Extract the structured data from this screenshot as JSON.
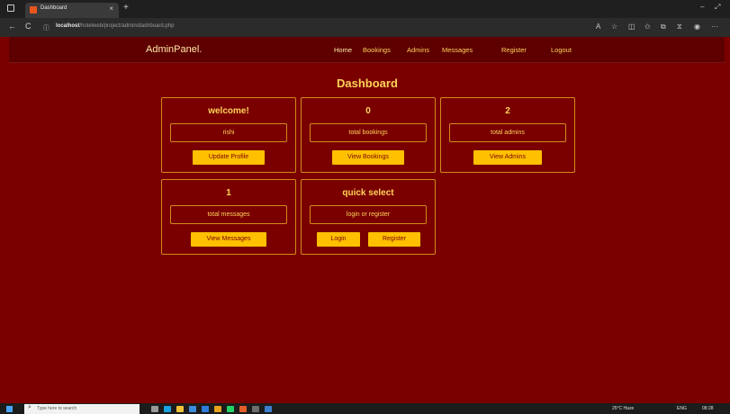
{
  "browser": {
    "tab_title": "Dashboard",
    "tab_close": "×",
    "new_tab": "+",
    "url_host": "localhost",
    "url_path": "/hotelweb/project/admin/dashboard.php",
    "window_controls": [
      "–",
      "⤢"
    ],
    "nav_icons": [
      "←",
      "C",
      "ⓘ"
    ],
    "toolbar_icons": [
      "A",
      "☆",
      "◫",
      "✩",
      "⧉",
      "⧖",
      "◉",
      "···"
    ]
  },
  "site": {
    "brand": "AdminPanel.",
    "menu": [
      "Home",
      "Bookings",
      "Admins",
      "Messages",
      "Register",
      "Logout"
    ],
    "page_title": "Dashboard",
    "cards": [
      {
        "heading": "welcome!",
        "field": "rishi",
        "buttons": [
          "Update Profile"
        ]
      },
      {
        "heading": "0",
        "field": "total bookings",
        "buttons": [
          "View Bookings"
        ]
      },
      {
        "heading": "2",
        "field": "total admins",
        "buttons": [
          "View Admins"
        ]
      },
      {
        "heading": "1",
        "field": "total messages",
        "buttons": [
          "View Messages"
        ]
      },
      {
        "heading": "quick select",
        "field": "login or register",
        "buttons": [
          "Login",
          "Register"
        ]
      }
    ]
  },
  "taskbar": {
    "search_placeholder": "Type here to search",
    "weather": "25°C Haze",
    "lang": "ENG",
    "time": "08:28"
  },
  "colors": {
    "page_bg": "#7a0000",
    "nav_bg": "#5e0000",
    "accent": "#ffd35a",
    "button_bg": "#ffc000",
    "border": "#d38a1a"
  }
}
